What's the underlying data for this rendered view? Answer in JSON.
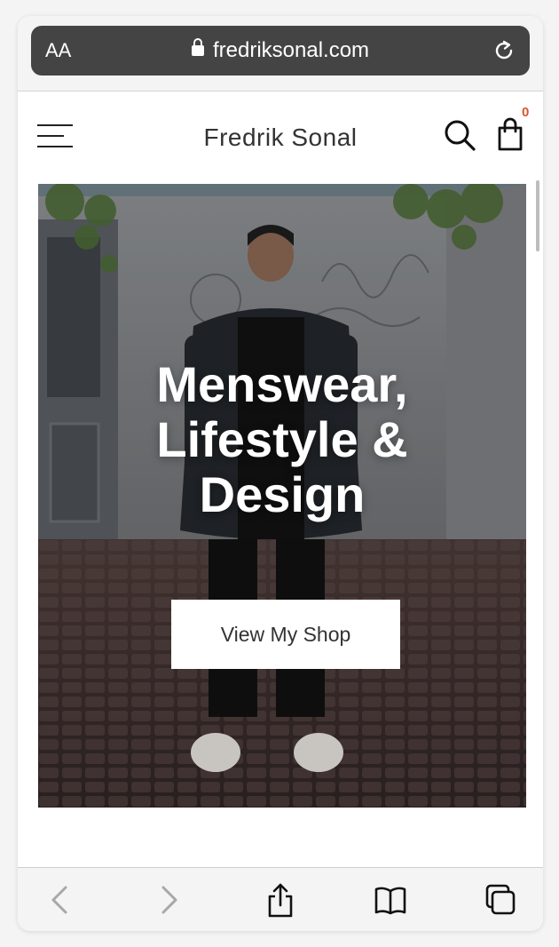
{
  "browser": {
    "text_size_label": "AA",
    "url": "fredriksonal.com"
  },
  "site": {
    "brand": "Fredrik Sonal",
    "cart_count": "0"
  },
  "hero": {
    "title_line1": "Menswear,",
    "title_line2": "Lifestyle &",
    "title_line3": "Design",
    "cta_label": "View My Shop"
  },
  "toolbar": {
    "icons": [
      "back-icon",
      "forward-icon",
      "share-icon",
      "bookmarks-icon",
      "tabs-icon"
    ]
  },
  "colors": {
    "url_bar": "#444444",
    "cart_count": "#d9552a",
    "chrome": "#f4f4f4"
  }
}
